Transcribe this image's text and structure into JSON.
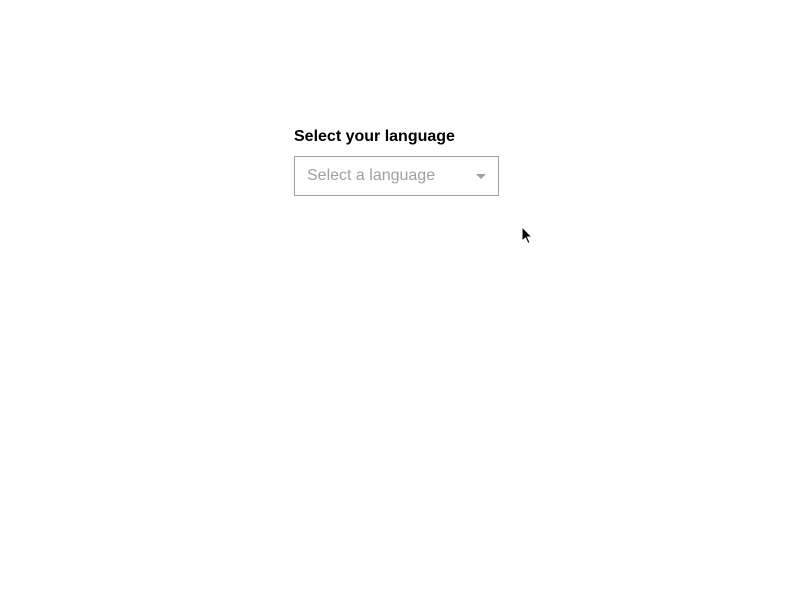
{
  "form": {
    "label": "Select your language",
    "select": {
      "placeholder": "Select a language"
    }
  }
}
